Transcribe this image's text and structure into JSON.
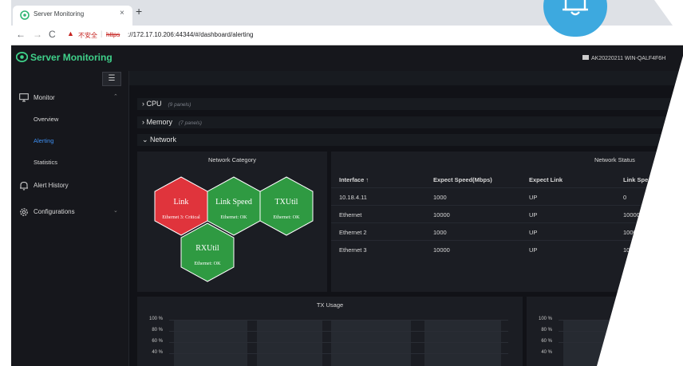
{
  "browser": {
    "tab_title": "Server Monitoring",
    "tab_close": "×",
    "new_tab": "+",
    "nav_back": "←",
    "nav_forward": "→",
    "nav_reload": "C",
    "warn_glyph": "▲",
    "not_secure": "不安全",
    "url_sep": "|",
    "url_scheme": "https",
    "url_rest": "://172.17.10.206:44344/#/dashboard/alerting"
  },
  "app": {
    "brand": "Server Monitoring",
    "host": "AK20220211  WIN-QALF4F6H"
  },
  "sidebar": {
    "toggle": "☰",
    "monitor": "Monitor",
    "monitor_sub": [
      "Overview",
      "Alerting",
      "Statistics"
    ],
    "active": "Alerting",
    "alert_history": "Alert History",
    "configurations": "Configurations",
    "chev_up": "⌃",
    "chev_down": "⌄"
  },
  "sections": {
    "cpu": {
      "label": "› CPU",
      "count": "(9 panels)"
    },
    "memory": {
      "label": "› Memory",
      "count": "(7 panels)"
    },
    "network": {
      "label": "⌄ Network"
    }
  },
  "network_category": {
    "title": "Network Category",
    "hexes": [
      {
        "name": "Link",
        "status": "Ethernet 3: Critical",
        "color": "#e0343c"
      },
      {
        "name": "Link Speed",
        "status": "Ethernet: OK",
        "color": "#2f9a42"
      },
      {
        "name": "TXUtil",
        "status": "Ethernet: OK",
        "color": "#2f9a42"
      },
      {
        "name": "RXUtil",
        "status": "Ethernet: OK",
        "color": "#2f9a42"
      }
    ]
  },
  "network_status": {
    "title": "Network Status",
    "columns": [
      "Interface ↑",
      "Expect Speed(Mbps)",
      "Expect Link",
      "Link Spe"
    ],
    "rows": [
      [
        "10.18.4.11",
        "1000",
        "UP",
        "0"
      ],
      [
        "Ethernet",
        "10000",
        "UP",
        "10000"
      ],
      [
        "Ethernet 2",
        "1000",
        "UP",
        "1000"
      ],
      [
        "Ethernet 3",
        "10000",
        "UP",
        "10"
      ]
    ]
  },
  "tx_usage": {
    "title": "TX Usage",
    "y_ticks": [
      "100 %",
      "80 %",
      "60 %",
      "40 %"
    ]
  },
  "rx_usage": {
    "y_ticks": [
      "100 %",
      "80 %",
      "60 %",
      "40 %"
    ]
  },
  "colors": {
    "accent": "#3fd18a",
    "active_link": "#3d8ef0",
    "critical": "#e0343c",
    "ok": "#2f9a42",
    "bell": "#3da9df"
  }
}
